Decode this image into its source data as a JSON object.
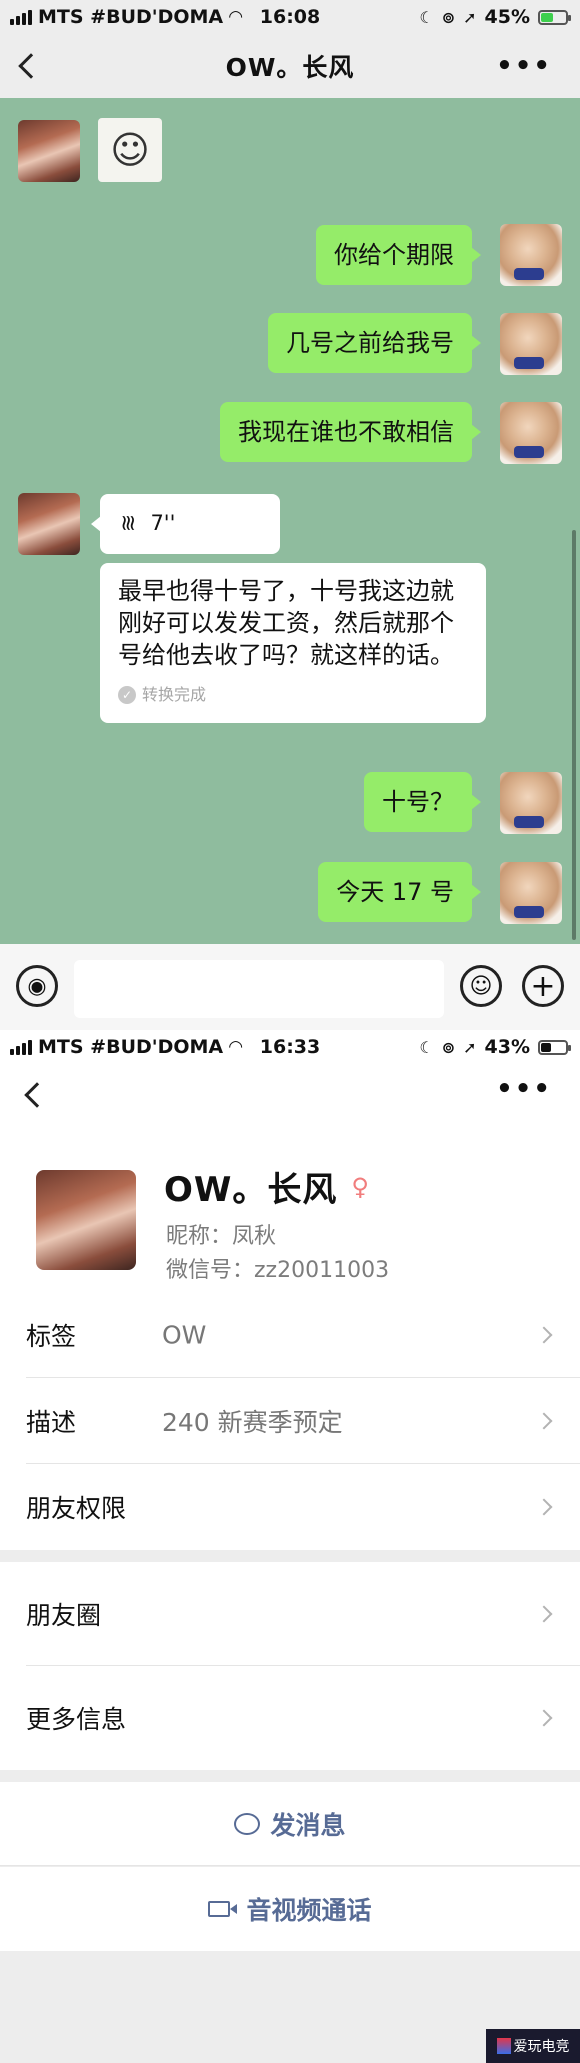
{
  "screen1": {
    "status": {
      "carrier": "MTS #BUD'DOMA",
      "time": "16:08",
      "battery": "45%",
      "battery_color": "#3ecf4d"
    },
    "chat_title": "OW。长风",
    "messages": [
      {
        "from": "me",
        "text": "你给个期限"
      },
      {
        "from": "me",
        "text": "几号之前给我号"
      },
      {
        "from": "me",
        "text": "我现在谁也不敢相信"
      },
      {
        "from": "other",
        "type": "voice",
        "duration": "7''"
      },
      {
        "from": "me",
        "text": "十号？"
      },
      {
        "from": "me",
        "text": "今天 17 号"
      }
    ],
    "transcript": {
      "text": "最早也得十号了，十号我这边就刚好可以发发工资，然后就那个号给他去收了吗？就这样的话。",
      "status": "转换完成"
    },
    "colors": {
      "chat_bg": "#8fbc9e",
      "my_bubble": "#95ec69"
    }
  },
  "screen2": {
    "status": {
      "carrier": "MTS #BUD'DOMA",
      "time": "16:33",
      "battery": "43%",
      "battery_color": "#111111"
    },
    "profile": {
      "name": "OW。长风",
      "nickname": "昵称：凤秋",
      "wechat_id": "微信号：zz20011003"
    },
    "rows": [
      {
        "label": "标签",
        "value": "OW"
      },
      {
        "label": "描述",
        "value": "240 新赛季预定"
      },
      {
        "label": "朋友权限",
        "value": ""
      },
      {
        "label": "朋友圈",
        "value": ""
      },
      {
        "label": "更多信息",
        "value": ""
      }
    ],
    "actions": {
      "send_message": "发消息",
      "video_call": "音视频通话"
    },
    "colors": {
      "link": "#576b95"
    }
  },
  "watermark": "爱玩电竞"
}
